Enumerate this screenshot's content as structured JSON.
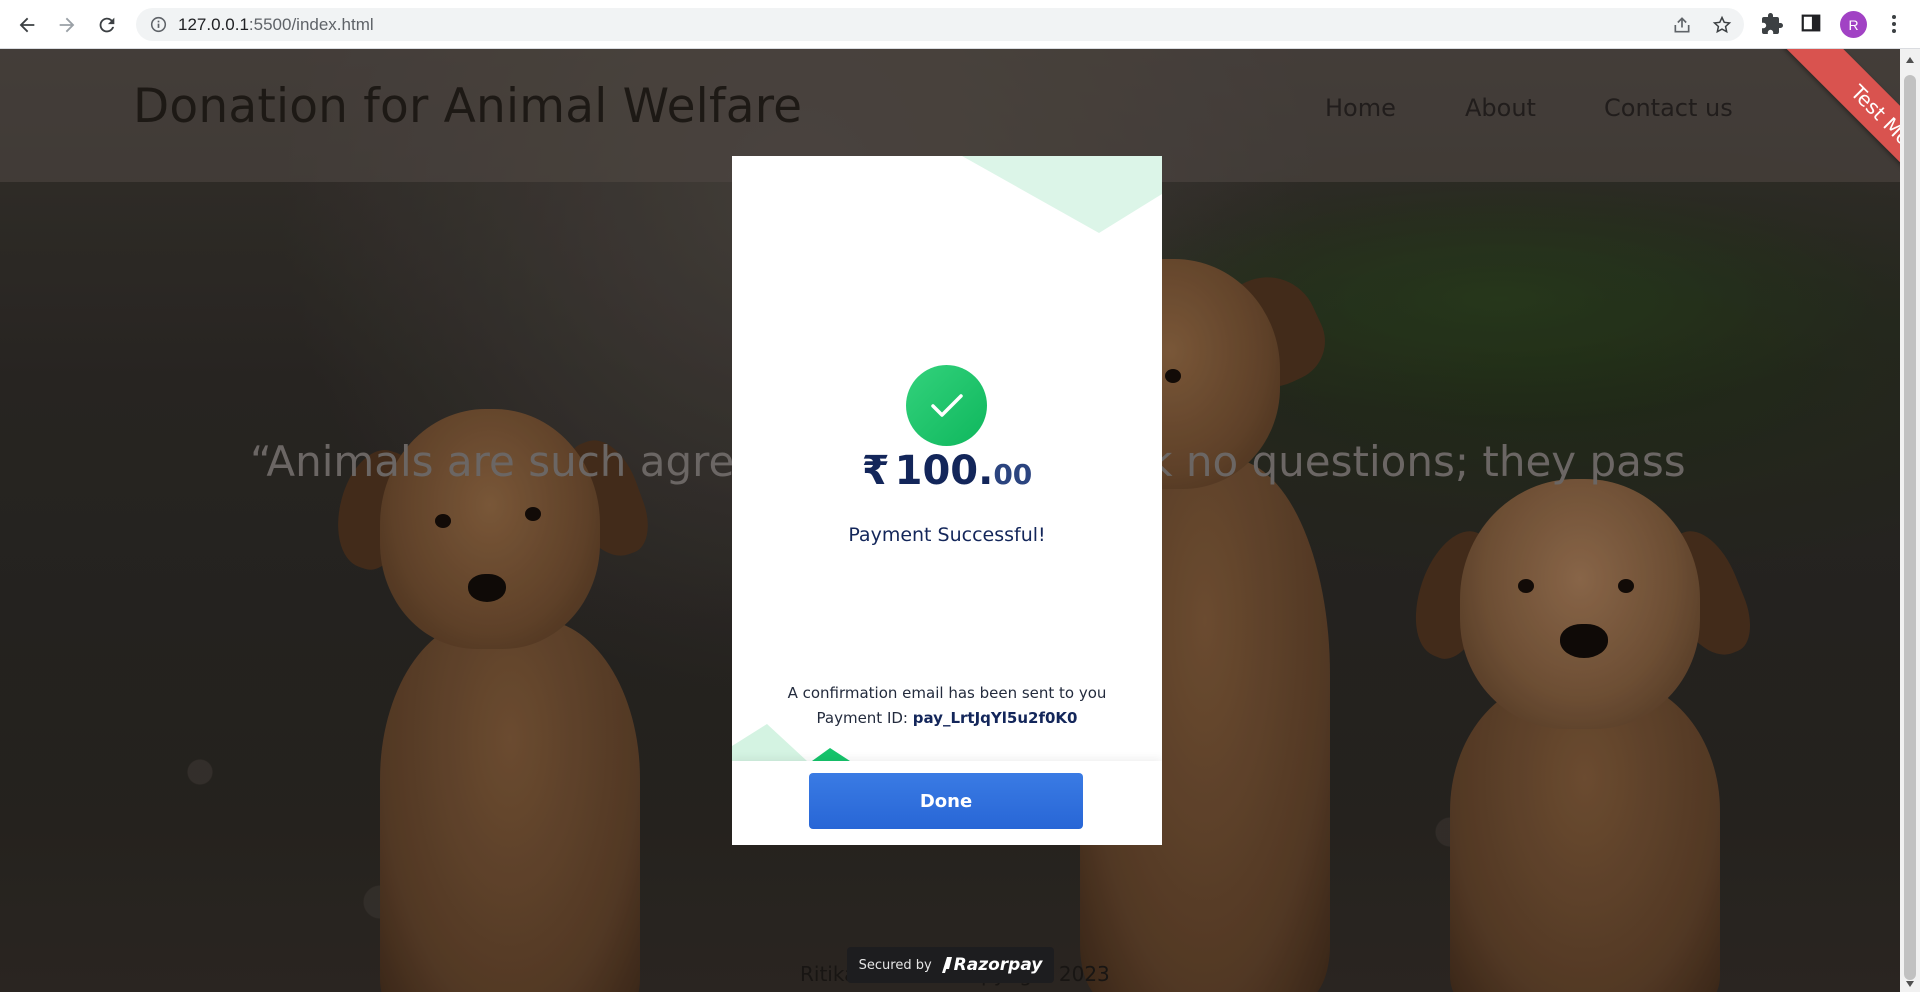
{
  "browser": {
    "url_host": "127.0.0.1",
    "url_rest": ":5500/index.html",
    "profile_initial": "R"
  },
  "site": {
    "title": "Donation for Animal Welfare",
    "nav": [
      "Home",
      "About",
      "Contact us"
    ],
    "quote": "“Animals are such agree",
    "quote_tail": "k no questions; they pass",
    "footer": "Ritika Gulati © Copyright 2023"
  },
  "ribbon": "Test Mode",
  "modal": {
    "currency": "₹",
    "amount_int": "100.",
    "amount_dec": "00",
    "status": "Payment Successful!",
    "confirmation": "A confirmation email has been sent to you",
    "payment_id_label": "Payment ID:",
    "payment_id": "pay_LrtJqYl5u2f0K0",
    "done_label": "Done"
  },
  "secured": {
    "label": "Secured by",
    "brand": "Razorpay"
  },
  "colors": {
    "success_green": "#1cc46b",
    "primary_blue": "#2f6fdc",
    "ribbon_red": "#d9534f",
    "navy_text": "#13265a"
  },
  "icons": [
    "back-arrow-icon",
    "forward-arrow-icon",
    "reload-icon",
    "info-icon",
    "share-icon",
    "star-icon",
    "extensions-icon",
    "side-panel-icon",
    "more-menu-icon",
    "checkmark-icon",
    "razorpay-logo-icon"
  ]
}
